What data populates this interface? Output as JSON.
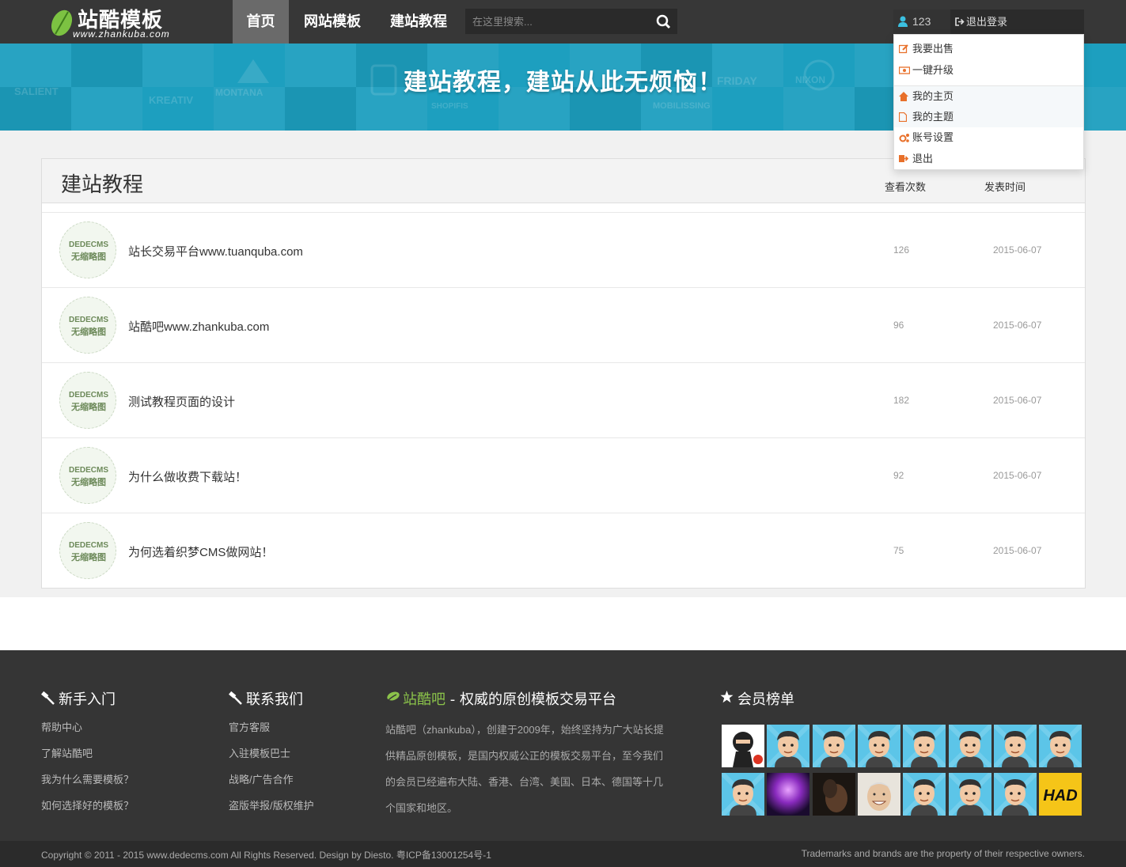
{
  "header": {
    "logo_text": "站酷模板",
    "logo_url": "www.zhankuba.com",
    "nav": [
      "首页",
      "网站模板",
      "建站教程"
    ],
    "search_placeholder": "在这里搜索...",
    "user_name": "123",
    "logout_label": "退出登录"
  },
  "banner": {
    "title": "建站教程，建站从此无烦恼！",
    "bg_words": [
      "SALIENT",
      "KREATIV",
      "MONTANA",
      "FRIDAY",
      "NIXON",
      "SHOPIFIS",
      "MOBILISSING"
    ]
  },
  "dropdown": {
    "items": [
      "我要出售",
      "一键升级",
      "我的主页",
      "我的主题",
      "账号设置",
      "退出"
    ]
  },
  "list": {
    "title": "建站教程",
    "col_views": "查看次数",
    "col_date": "发表时间",
    "thumb_line1": "DEDECMS",
    "thumb_line2": "无缩略图",
    "rows": [
      {
        "title": "站长交易平台www.tuanquba.com",
        "views": "126",
        "date": "2015-06-07"
      },
      {
        "title": "站酷吧www.zhankuba.com",
        "views": "96",
        "date": "2015-06-07"
      },
      {
        "title": "测试教程页面的设计",
        "views": "182",
        "date": "2015-06-07"
      },
      {
        "title": "为什么做收费下载站！",
        "views": "92",
        "date": "2015-06-07"
      },
      {
        "title": "为何选着织梦CMS做网站！",
        "views": "75",
        "date": "2015-06-07"
      }
    ]
  },
  "footer": {
    "col1": {
      "title": "新手入门",
      "links": [
        "帮助中心",
        "了解站酷吧",
        "我为什么需要模板？",
        "如何选择好的模板？"
      ]
    },
    "col2": {
      "title": "联系我们",
      "links": [
        "官方客服",
        "入驻模板巴士",
        "战略/广告合作",
        "盗版举报/版权维护"
      ]
    },
    "col3": {
      "brand": "站酷吧",
      "title_rest": " - 权威的原创模板交易平台",
      "text": "站酷吧（zhankuba），创建于2009年，始终坚持为广大站长提供精品原创模板，是国内权威公正的模板交易平台，至今我们的会员已经遍布大陆、香港、台湾、美国、日本、德国等十几个国家和地区。"
    },
    "col4": {
      "title": "会员榜单",
      "avatars": [
        "ninja",
        "cartoon-man",
        "cartoon-man",
        "cartoon-man",
        "cartoon-man",
        "cartoon-man",
        "cartoon-man",
        "cartoon-man",
        "cartoon-man",
        "purple-galaxy",
        "dark-photo",
        "smiling-person",
        "cartoon-man",
        "cartoon-man",
        "cartoon-man",
        "had-logo"
      ],
      "had_text": "HAD"
    },
    "copyright": "Copyright © 2011 - 2015 www.dedecms.com All Rights Reserved. Design by Diesto. 粤ICP备13001254号-1",
    "trademark": "Trademarks and brands are the property of their respective owners."
  },
  "colors": {
    "banner": "#1d9fbf",
    "header": "#373737",
    "footer": "#353535",
    "accent_orange": "#e8702a",
    "brand_green": "#8bc34a"
  }
}
